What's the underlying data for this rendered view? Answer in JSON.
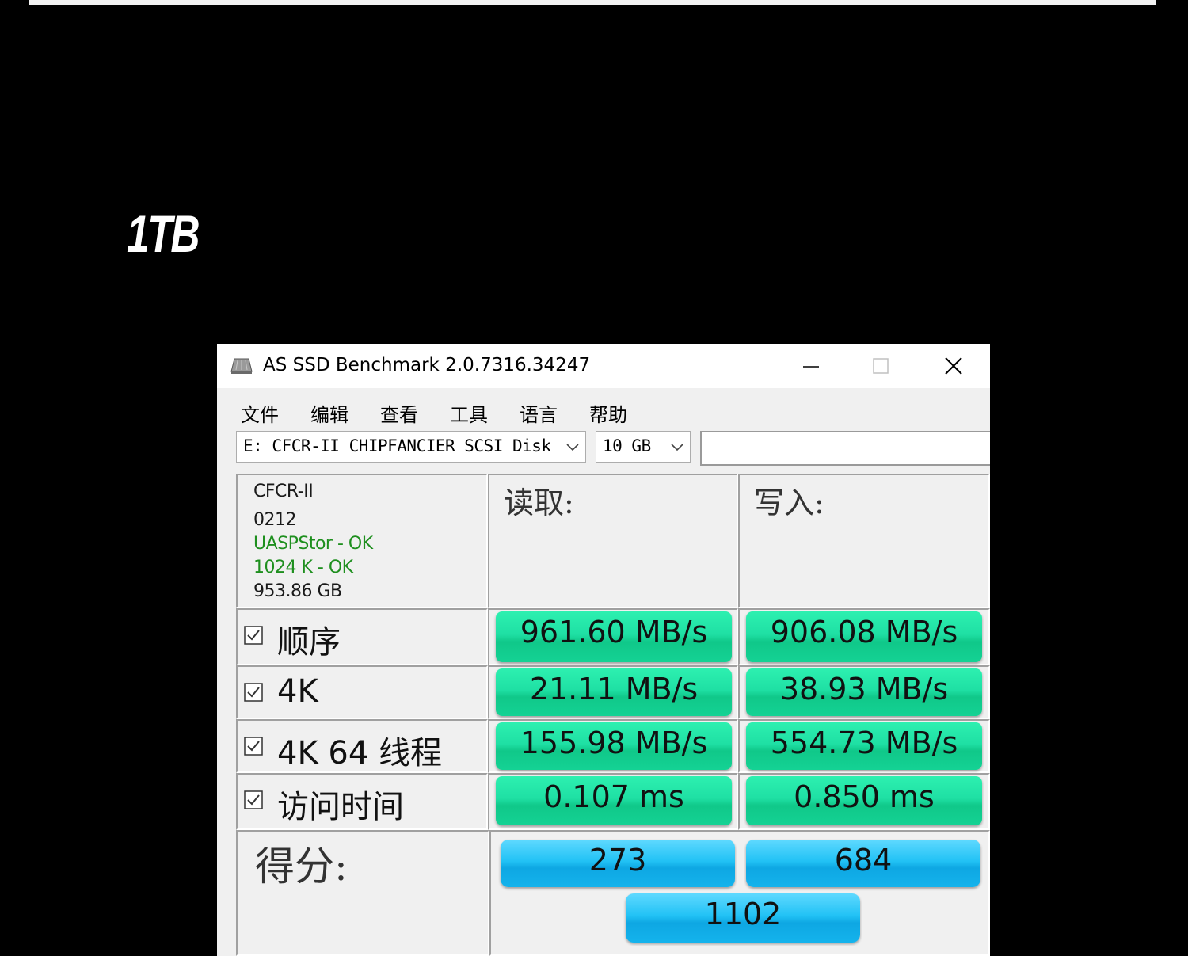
{
  "capacity_label": "1TB",
  "window": {
    "title": "AS SSD Benchmark 2.0.7316.34247"
  },
  "menu": [
    "文件",
    "编辑",
    "查看",
    "工具",
    "语言",
    "帮助"
  ],
  "toolbar": {
    "drive_value": "E: CFCR-II CHIPFANCIER SCSI Disk",
    "size_value": "10 GB",
    "text_field_value": ""
  },
  "device_info": {
    "model": "CFCR-II",
    "firmware": "0212",
    "driver_status": "UASPStor - OK",
    "alignment_status": "1024 K - OK",
    "capacity": "953.86 GB"
  },
  "columns": {
    "read": "读取:",
    "write": "写入:"
  },
  "rows": [
    {
      "label": "顺序",
      "checked": true,
      "read": "961.60 MB/s",
      "write": "906.08 MB/s"
    },
    {
      "label": "4K",
      "checked": true,
      "read": "21.11 MB/s",
      "write": "38.93 MB/s"
    },
    {
      "label": "4K 64 线程",
      "checked": true,
      "read": "155.98 MB/s",
      "write": "554.73 MB/s"
    },
    {
      "label": "访问时间",
      "checked": true,
      "read": "0.107 ms",
      "write": "0.850 ms"
    }
  ],
  "score": {
    "label": "得分:",
    "read": "273",
    "write": "684",
    "total": "1102"
  },
  "colors": {
    "result_bar": "#1fe0a4",
    "score_bar": "#22c2f5",
    "status_ok": "#1e8f1e"
  },
  "icons": {
    "app": "drive-icon",
    "minimize": "minimize-icon",
    "maximize": "maximize-icon",
    "close": "close-icon",
    "dropdown": "chevron-down-icon",
    "checkbox": "checkbox-checked-icon"
  }
}
